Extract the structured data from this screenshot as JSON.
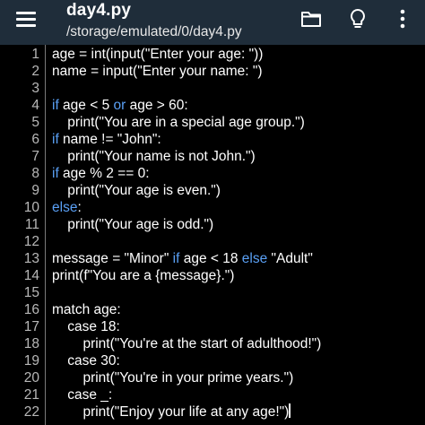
{
  "app_bar": {
    "menu_icon": "hamburger-menu-icon",
    "file_name": "day4.py",
    "file_path": "/storage/emulated/0/day4.py",
    "actions": [
      {
        "name": "open-folder-button",
        "icon": "folder-icon"
      },
      {
        "name": "hint-button",
        "icon": "lightbulb-icon"
      },
      {
        "name": "more-options-button",
        "icon": "vertical-dots-icon"
      }
    ],
    "bar_color": "#1f2d3a"
  },
  "editor": {
    "keyword_color": "#5aa0f5",
    "lines": [
      {
        "num": "1",
        "tokens": [
          {
            "t": "age = int(input(\"Enter your age: \"))",
            "k": "n"
          }
        ]
      },
      {
        "num": "2",
        "tokens": [
          {
            "t": "name = input(\"Enter your name: \")",
            "k": "n"
          }
        ]
      },
      {
        "num": "3",
        "tokens": []
      },
      {
        "num": "4",
        "tokens": [
          {
            "t": "if",
            "k": "kw"
          },
          {
            "t": " age < 5 ",
            "k": "n"
          },
          {
            "t": "or",
            "k": "kw"
          },
          {
            "t": " age > 60:",
            "k": "n"
          }
        ]
      },
      {
        "num": "5",
        "tokens": [
          {
            "t": "    print(\"You are in a special age group.\")",
            "k": "n"
          }
        ]
      },
      {
        "num": "6",
        "tokens": [
          {
            "t": "if",
            "k": "kw"
          },
          {
            "t": " name != \"John\":",
            "k": "n"
          }
        ]
      },
      {
        "num": "7",
        "tokens": [
          {
            "t": "    print(\"Your name is not John.\")",
            "k": "n"
          }
        ]
      },
      {
        "num": "8",
        "tokens": [
          {
            "t": "if",
            "k": "kw"
          },
          {
            "t": " age % 2 == 0:",
            "k": "n"
          }
        ]
      },
      {
        "num": "9",
        "tokens": [
          {
            "t": "    print(\"Your age is even.\")",
            "k": "n"
          }
        ]
      },
      {
        "num": "10",
        "tokens": [
          {
            "t": "else",
            "k": "kw"
          },
          {
            "t": ":",
            "k": "n"
          }
        ]
      },
      {
        "num": "11",
        "tokens": [
          {
            "t": "    print(\"Your age is odd.\")",
            "k": "n"
          }
        ]
      },
      {
        "num": "12",
        "tokens": []
      },
      {
        "num": "13",
        "tokens": [
          {
            "t": "message = \"Minor\" ",
            "k": "n"
          },
          {
            "t": "if",
            "k": "kw"
          },
          {
            "t": " age < 18 ",
            "k": "n"
          },
          {
            "t": "else",
            "k": "kw"
          },
          {
            "t": " \"Adult\"",
            "k": "n"
          }
        ]
      },
      {
        "num": "14",
        "tokens": [
          {
            "t": "print(f\"You are a {message}.\")",
            "k": "n"
          }
        ]
      },
      {
        "num": "15",
        "tokens": []
      },
      {
        "num": "16",
        "tokens": [
          {
            "t": "match age:",
            "k": "n"
          }
        ]
      },
      {
        "num": "17",
        "tokens": [
          {
            "t": "    case 18:",
            "k": "n"
          }
        ]
      },
      {
        "num": "18",
        "tokens": [
          {
            "t": "        print(\"You're at the start of adulthood!\")",
            "k": "n"
          }
        ]
      },
      {
        "num": "19",
        "tokens": [
          {
            "t": "    case 30:",
            "k": "n"
          }
        ]
      },
      {
        "num": "20",
        "tokens": [
          {
            "t": "        print(\"You're in your prime years.\")",
            "k": "n"
          }
        ]
      },
      {
        "num": "21",
        "tokens": [
          {
            "t": "    case _:",
            "k": "n"
          }
        ]
      },
      {
        "num": "22",
        "tokens": [
          {
            "t": "        print(\"Enjoy your life at any age!\")",
            "k": "n"
          }
        ],
        "cursor": true
      }
    ]
  }
}
